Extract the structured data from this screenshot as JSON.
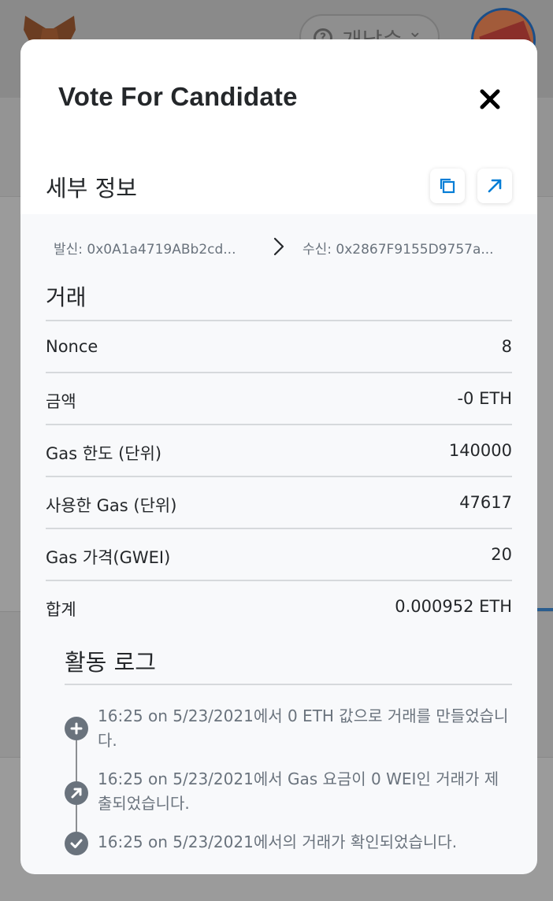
{
  "modal": {
    "title": "Vote For Candidate",
    "close_icon": "close-icon"
  },
  "details": {
    "heading": "세부 정보",
    "copy_icon": "copy-icon",
    "explorer_icon": "external-link-icon",
    "from": "발신: 0x0A1a4719ABb2cd...",
    "to": "수신: 0x2867F9155D9757a..."
  },
  "transaction": {
    "heading": "거래",
    "rows": [
      {
        "label": "Nonce",
        "value": "8"
      },
      {
        "label": "금액",
        "value": "-0 ETH"
      },
      {
        "label": "Gas 한도 (단위)",
        "value": "140000"
      },
      {
        "label": "사용한 Gas (단위)",
        "value": "47617"
      },
      {
        "label": "Gas 가격(GWEI)",
        "value": "20"
      },
      {
        "label": "합계",
        "value": "0.000952 ETH"
      }
    ]
  },
  "activity_log": {
    "heading": "활동 로그",
    "items": [
      {
        "icon": "plus-icon",
        "text": "16:25 on 5/23/2021에서 0 ETH 값으로 거래를 만들었습니다."
      },
      {
        "icon": "arrow-up-right-icon",
        "text": "16:25 on 5/23/2021에서 Gas 요금이 0 WEI인 거래가 제출되었습니다."
      },
      {
        "icon": "check-icon",
        "text": "16:25 on 5/23/2021에서의 거래가 확인되었습니다."
      }
    ]
  },
  "background": {
    "network_label": "개납승"
  },
  "colors": {
    "accent": "#037dd6",
    "text_primary": "#24272a",
    "text_muted": "#6a737d",
    "divider": "#d6d9dc"
  }
}
